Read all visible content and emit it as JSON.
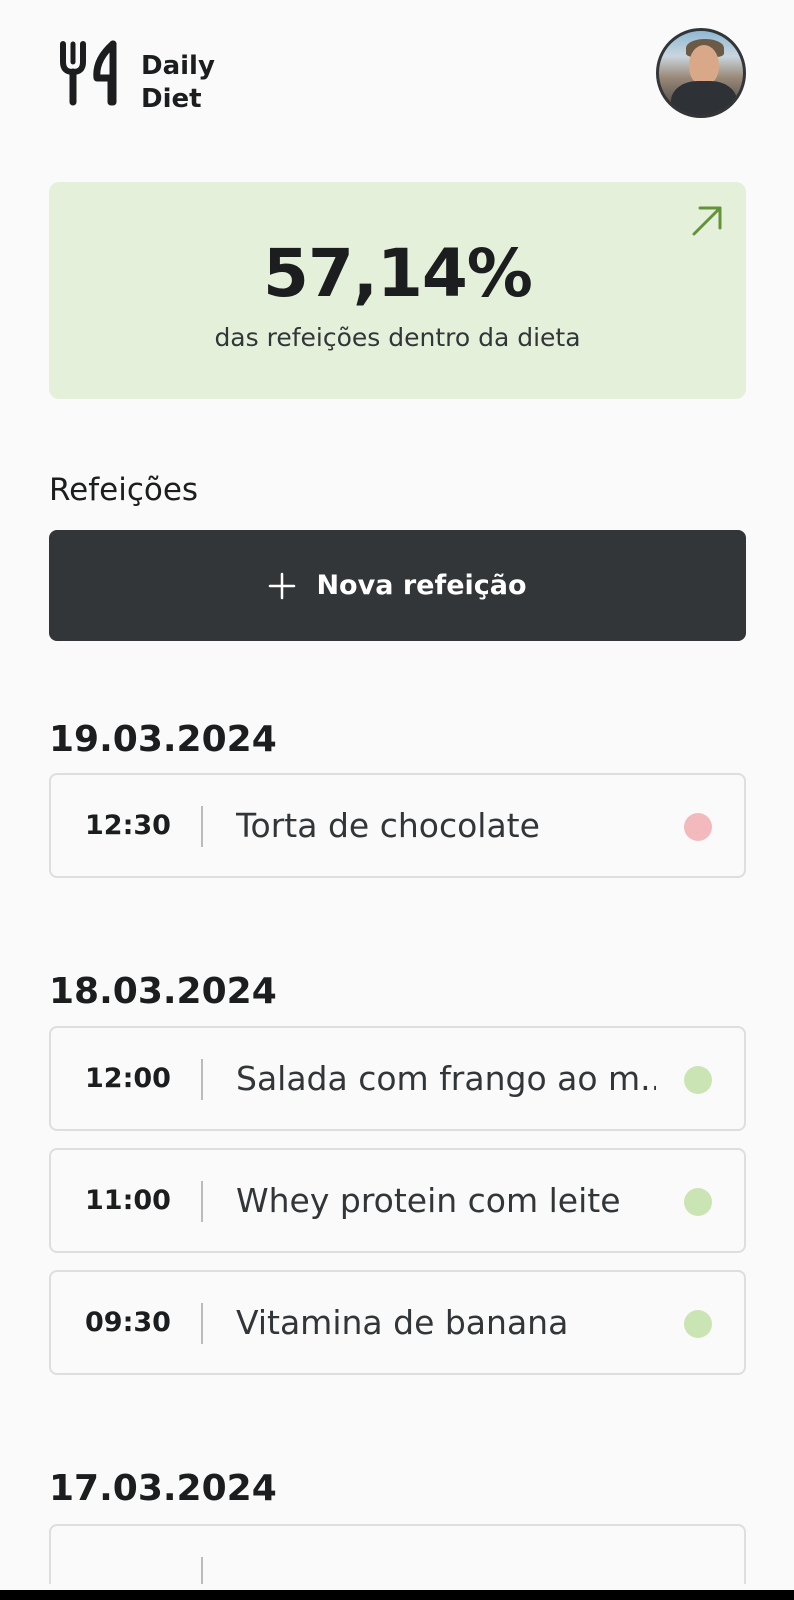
{
  "app": {
    "logo_line1": "Daily",
    "logo_line2": "Diet",
    "avatar_icon": "user-avatar"
  },
  "stats": {
    "percentage": "57,14%",
    "label": "das refeições dentro da dieta",
    "background": "#e5f0db",
    "arrow_color": "#639339",
    "arrow_icon": "arrow-up-right-icon"
  },
  "meals": {
    "section_title": "Refeições",
    "new_button_label": "Nova refeição",
    "new_button_icon": "plus-icon",
    "in_diet_color": "#cbe4b4",
    "off_diet_color": "#f3babd",
    "days": [
      {
        "date": "19.03.2024",
        "items": [
          {
            "time": "12:30",
            "name": "Torta de chocolate",
            "in_diet": false
          }
        ]
      },
      {
        "date": "18.03.2024",
        "items": [
          {
            "time": "12:00",
            "name": "Salada com frango ao m...",
            "in_diet": true
          },
          {
            "time": "11:00",
            "name": "Whey protein com leite",
            "in_diet": true
          },
          {
            "time": "09:30",
            "name": "Vitamina de banana",
            "in_diet": true
          }
        ]
      },
      {
        "date": "17.03.2024",
        "items": []
      }
    ]
  }
}
